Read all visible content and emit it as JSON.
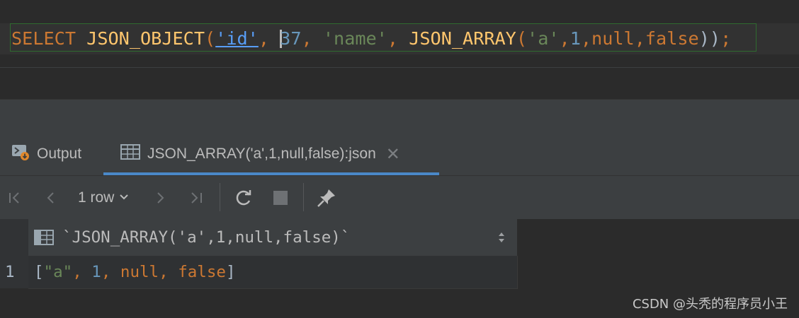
{
  "editor": {
    "sql_tokens": [
      {
        "t": "SELECT",
        "c": "kw"
      },
      {
        "t": " ",
        "c": "pl"
      },
      {
        "t": "JSON_OBJECT",
        "c": "fn"
      },
      {
        "t": "(",
        "c": "kw"
      },
      {
        "t": "'id'",
        "c": "link"
      },
      {
        "t": ", ",
        "c": "kw"
      },
      {
        "t": "",
        "c": "caret"
      },
      {
        "t": "37",
        "c": "num"
      },
      {
        "t": ", ",
        "c": "kw"
      },
      {
        "t": "'name'",
        "c": "str"
      },
      {
        "t": ", ",
        "c": "kw"
      },
      {
        "t": "JSON_ARRAY",
        "c": "fn"
      },
      {
        "t": "(",
        "c": "kw"
      },
      {
        "t": "'a'",
        "c": "str"
      },
      {
        "t": ",",
        "c": "kw"
      },
      {
        "t": "1",
        "c": "num"
      },
      {
        "t": ",",
        "c": "kw"
      },
      {
        "t": "null",
        "c": "kw"
      },
      {
        "t": ",",
        "c": "kw"
      },
      {
        "t": "false",
        "c": "kw"
      },
      {
        "t": "))",
        "c": "pl"
      },
      {
        "t": ";",
        "c": "kw"
      }
    ]
  },
  "tabs": {
    "output_label": "Output",
    "result_label": "JSON_ARRAY('a',1,null,false):json",
    "close_glyph": "✕"
  },
  "toolbar": {
    "first_glyph": "|‹",
    "prev_glyph": "‹",
    "rows_label": "1 row",
    "rows_chevron": "⌄",
    "next_glyph": "›",
    "last_glyph": "›|",
    "refresh_glyph": "⟳",
    "stop_glyph": "■",
    "pin_glyph": "📌"
  },
  "grid": {
    "column_title": "`JSON_ARRAY('a',1,null,false)`",
    "row_number": "1",
    "cell_tokens": [
      {
        "t": "[",
        "c": "pl"
      },
      {
        "t": "\"a\"",
        "c": "str"
      },
      {
        "t": ", ",
        "c": "kw"
      },
      {
        "t": "1",
        "c": "num"
      },
      {
        "t": ", ",
        "c": "kw"
      },
      {
        "t": "null",
        "c": "kw"
      },
      {
        "t": ", ",
        "c": "kw"
      },
      {
        "t": "false",
        "c": "kw"
      },
      {
        "t": "]",
        "c": "pl"
      }
    ]
  },
  "watermark": "CSDN @头秃的程序员小王",
  "colors": {
    "keyword": "#cc7832",
    "function": "#ffc66d",
    "string": "#6a8759",
    "number": "#6897bb",
    "link": "#589df6",
    "accent": "#4a88c7"
  }
}
